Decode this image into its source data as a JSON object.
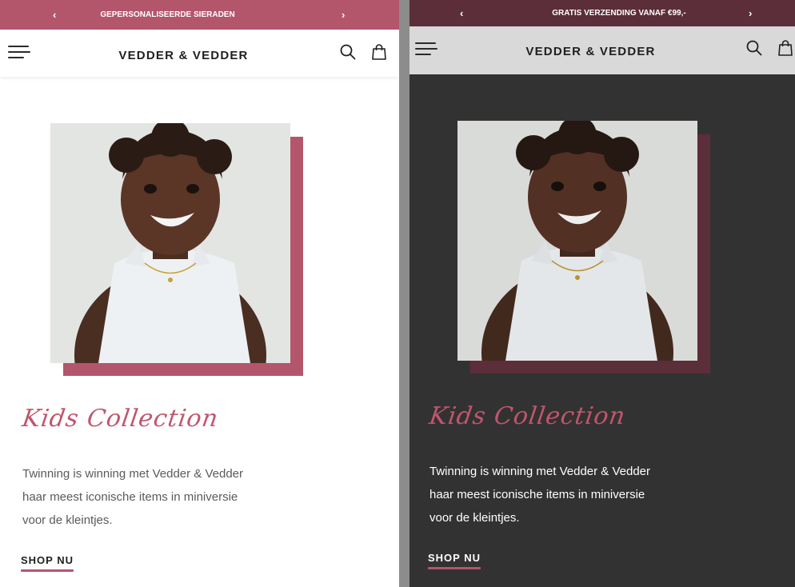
{
  "left": {
    "promo": {
      "prev": "‹",
      "message": "GEPERSONALISEERDE SIERADEN",
      "next": "›"
    },
    "brand": "VEDDER & VEDDER",
    "collection_title": "Kids Collection",
    "body_lines": [
      "Twinning is winning met Vedder & Vedder",
      "haar meest iconische items in miniversie",
      "voor de kleintjes."
    ],
    "cta": "SHOP NU"
  },
  "right": {
    "promo": {
      "prev": "‹",
      "message": "GRATIS VERZENDING VANAF €99,-",
      "next": "›"
    },
    "brand": "VEDDER & VEDDER",
    "collection_title": "Kids Collection",
    "body_lines": [
      "Twinning is winning met Vedder & Vedder",
      "haar meest iconische items in miniversie",
      "voor de kleintjes."
    ],
    "cta": "SHOP NU"
  },
  "icons": {
    "menu": "hamburger-menu-icon",
    "search": "search-icon",
    "cart": "shopping-bag-icon"
  },
  "colors": {
    "accent": "#b3566b",
    "accent_dark": "#5b2e3a",
    "dark_background": "#333232"
  }
}
